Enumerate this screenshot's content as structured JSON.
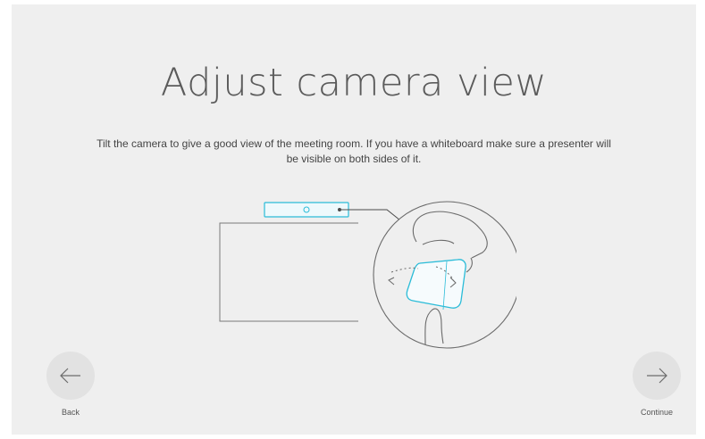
{
  "page": {
    "title": "Adjust camera view",
    "description": "Tilt the camera to give a good view of the meeting room. If you have a whiteboard make sure a presenter will be visible on both sides of it."
  },
  "navigation": {
    "back_label": "Back",
    "continue_label": "Continue",
    "back_icon": "arrow-left-icon",
    "continue_icon": "arrow-right-icon"
  },
  "colors": {
    "background": "#efefef",
    "accent": "#2bbcd8",
    "line": "#6f6f6f",
    "button": "#e2e2e2"
  }
}
